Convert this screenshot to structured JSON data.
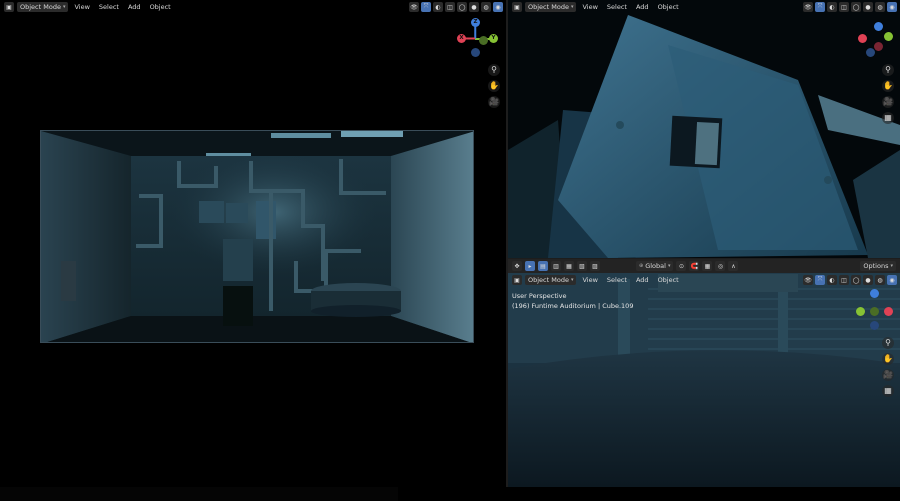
{
  "viewport_left": {
    "mode_label": "Object Mode",
    "menus": [
      "View",
      "Select",
      "Add",
      "Object"
    ],
    "gizmo": {
      "z": "Z",
      "y": "Y",
      "x": "X"
    }
  },
  "viewport_top_right": {
    "mode_label": "Object Mode",
    "menus": [
      "View",
      "Select",
      "Add",
      "Object"
    ]
  },
  "viewport_bottom_right": {
    "tool_header": {
      "orientation": "Global",
      "options_label": "Options"
    },
    "mode_label": "Object Mode",
    "menus": [
      "View",
      "Select",
      "Add",
      "Object"
    ],
    "overlay_line1": "User Perspective",
    "overlay_line2": "(196) Funtime Auditorium | Cube.109"
  },
  "colors": {
    "axis_x": "#e04255",
    "axis_y": "#86c234",
    "axis_z": "#3f7fdc",
    "accent": "#4772b3"
  }
}
